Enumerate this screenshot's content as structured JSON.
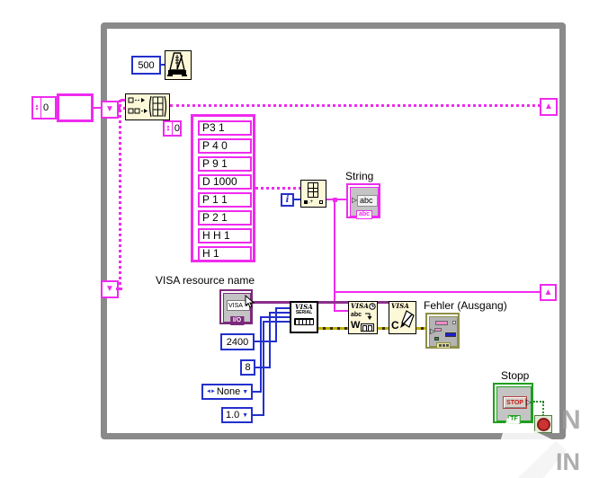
{
  "loop": {
    "type": "while-loop"
  },
  "constants": {
    "wait_ms": "500",
    "outer_array_index": "0",
    "inner_array_index": "0",
    "baud_rate": "2400",
    "data_bits": "8",
    "parity": "None",
    "stop_bits": "1.0",
    "iteration": "i"
  },
  "string_array": {
    "items": [
      "P3 1",
      "P 4 0",
      "P 9 1",
      "D 1000",
      "P 1 1",
      "P 2 1",
      "H H 1",
      "H 1"
    ]
  },
  "indicators": {
    "string_label": "String",
    "string_value": "abc",
    "string_type": "abc",
    "error_label": "Fehler (Ausgang)"
  },
  "controls": {
    "visa_label": "VISA resource name",
    "visa_value": "VISA",
    "visa_type": "I/O",
    "stop_label": "Stopp",
    "stop_button": "STOP",
    "stop_type": "TF"
  },
  "nodes": {
    "visa_serial_line1": "VISA",
    "visa_serial_line2": "SERIAL",
    "visa_write_title": "VISA",
    "visa_write_abc": "abc",
    "visa_write_letter": "W",
    "visa_close_title": "VISA",
    "visa_close_letter": "C"
  },
  "icons": {
    "tunnel_up": "▲",
    "tunnel_down": "▼",
    "spinner_up": "▲",
    "spinner_down": "▼",
    "dropdown": "▼",
    "ring_arrows": "◄►",
    "input_arrow": "▷",
    "output_arrow": "▷"
  },
  "watermark": {
    "letter_top": "N",
    "letter_bottom": "IN"
  },
  "colors": {
    "string_pink": "#ef2bef",
    "numeric_blue": "#2330cc",
    "visa_purple": "#8b2f8b",
    "bool_green": "#1f9e1f",
    "error_olive": "#8f8f4b",
    "node_bg": "#fdf8d8",
    "loop_gray": "#8a8a8a"
  }
}
